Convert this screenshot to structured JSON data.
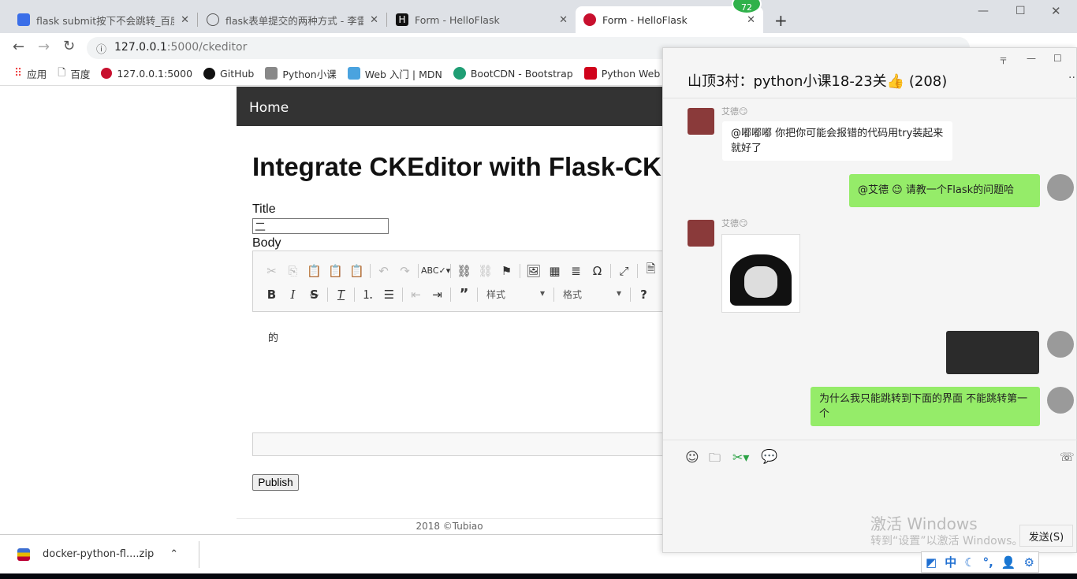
{
  "browser": {
    "tabs": [
      {
        "title": "flask submit按下不会跳转_百度搜索",
        "icon": "baidu-icon",
        "active": false
      },
      {
        "title": "flask表单提交的两种方式 - 李雷的博客",
        "icon": "blog-icon",
        "active": false
      },
      {
        "title": "Form - HelloFlask",
        "icon": "helloflask-h-icon",
        "active": false
      },
      {
        "title": "Form - HelloFlask",
        "icon": "flask-red-icon",
        "active": true
      }
    ],
    "badge": "72",
    "url_host": "127.0.0.1",
    "url_rest": ":5000/ckeditor",
    "bookmarks": [
      "应用",
      "百度",
      "127.0.0.1:5000",
      "GitHub",
      "Python小课",
      "Web 入门 | MDN",
      "BootCDN - Bootstrap",
      "Python Web"
    ]
  },
  "page": {
    "nav_home": "Home",
    "heading": "Integrate CKEditor with Flask-CKEditor",
    "title_label": "Title",
    "title_value": "二",
    "body_label": "Body",
    "editor_content": "的",
    "style_combo": "样式",
    "format_combo": "格式",
    "publish_label": "Publish",
    "footer": "2018 ©Tubiao"
  },
  "download": {
    "file": "docker-python-fl....zip"
  },
  "chat": {
    "title": "山顶3村：python小课18-23关👍 (208)",
    "messages": [
      {
        "sender": "艾德😏",
        "text": "@嘟嘟嘟 你把你可能会报错的代码用try装起来就好了",
        "side": "left"
      },
      {
        "sender": "",
        "text": "@艾德 😉 请教一个Flask的问题哈",
        "side": "right"
      },
      {
        "sender": "艾德😏",
        "text": "",
        "side": "left",
        "image": "meme-sticker"
      },
      {
        "sender": "",
        "text": "",
        "side": "right",
        "image": "code-screenshot"
      },
      {
        "sender": "",
        "text": "为什么我只能跳转到下面的界面 不能跳转第一个",
        "side": "right"
      }
    ],
    "send_label": "发送(S)",
    "watermark_title": "激活 Windows",
    "watermark_sub": "转到“设置”以激活 Windows。"
  },
  "ime": {
    "mode": "中"
  }
}
